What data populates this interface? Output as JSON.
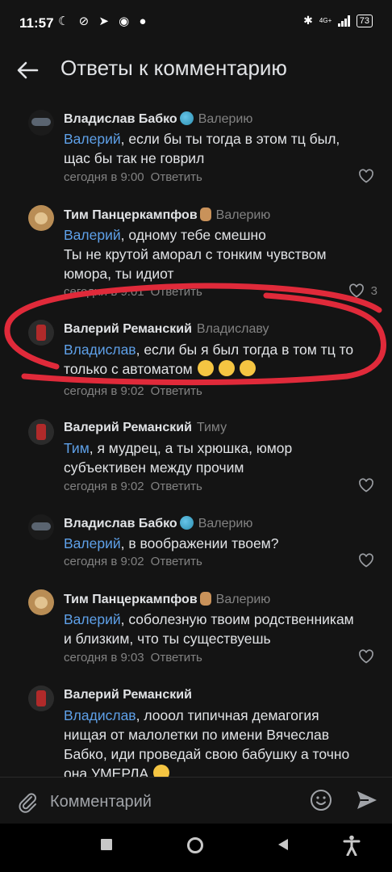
{
  "status_bar": {
    "time": "11:57",
    "icons": "☾ ⊘ ➤ ◉ ●",
    "network": "4G+",
    "battery": "73"
  },
  "header": {
    "title": "Ответы к комментарию"
  },
  "comments": [
    {
      "author": "Владислав Бабко",
      "reply_to": "Валерию",
      "mention": "Валерий",
      "lines": [
        ", если бы ты тогда в этом тц был,",
        "щас бы так не говрил"
      ],
      "time": "сегодня в 9:00",
      "reply_label": "Ответить",
      "likes": ""
    },
    {
      "author": "Тим Панцеркампфов",
      "reply_to": "Валерию",
      "mention": "Валерий",
      "lines": [
        ", одному тебе смешно",
        "Ты не крутой аморал с тонким чувством",
        "юмора, ты идиот"
      ],
      "time": "сегодня в 9:01",
      "reply_label": "Ответить",
      "likes": "3"
    },
    {
      "author": "Валерий Реманский",
      "reply_to": "Владиславу",
      "mention": "Владислав",
      "lines": [
        ", если бы я был тогда в том тц то",
        "только с автоматом"
      ],
      "time": "сегодня в 9:02",
      "reply_label": "Ответить",
      "likes": ""
    },
    {
      "author": "Валерий Реманский",
      "reply_to": "Тиму",
      "mention": "Тим",
      "lines": [
        ", я мудрец, а ты хрюшка, юмор",
        "субъективен между прочим"
      ],
      "time": "сегодня в 9:02",
      "reply_label": "Ответить",
      "likes": ""
    },
    {
      "author": "Владислав Бабко",
      "reply_to": "Валерию",
      "mention": "Валерий",
      "lines": [
        ", в воображении твоем?"
      ],
      "time": "сегодня в 9:02",
      "reply_label": "Ответить",
      "likes": ""
    },
    {
      "author": "Тим Панцеркампфов",
      "reply_to": "Валерию",
      "mention": "Валерий",
      "lines": [
        ", соболезную твоим родственникам",
        "и близким, что ты существуешь"
      ],
      "time": "сегодня в 9:03",
      "reply_label": "Ответить",
      "likes": ""
    },
    {
      "author": "Валерий Реманский",
      "reply_to": "",
      "mention": "Владислав",
      "lines": [
        ", лооол типичная демагогия",
        "нищая от малолетки по имени Вячеслав",
        "Бабко, иди проведай свою бабушку а точно",
        "она УМЕРЛА"
      ],
      "time": "",
      "reply_label": "",
      "likes": ""
    }
  ],
  "composer": {
    "placeholder": "Комментарий"
  },
  "colors": {
    "accent": "#5ea0e8",
    "background": "#141414",
    "annotation": "#e02a3a"
  }
}
